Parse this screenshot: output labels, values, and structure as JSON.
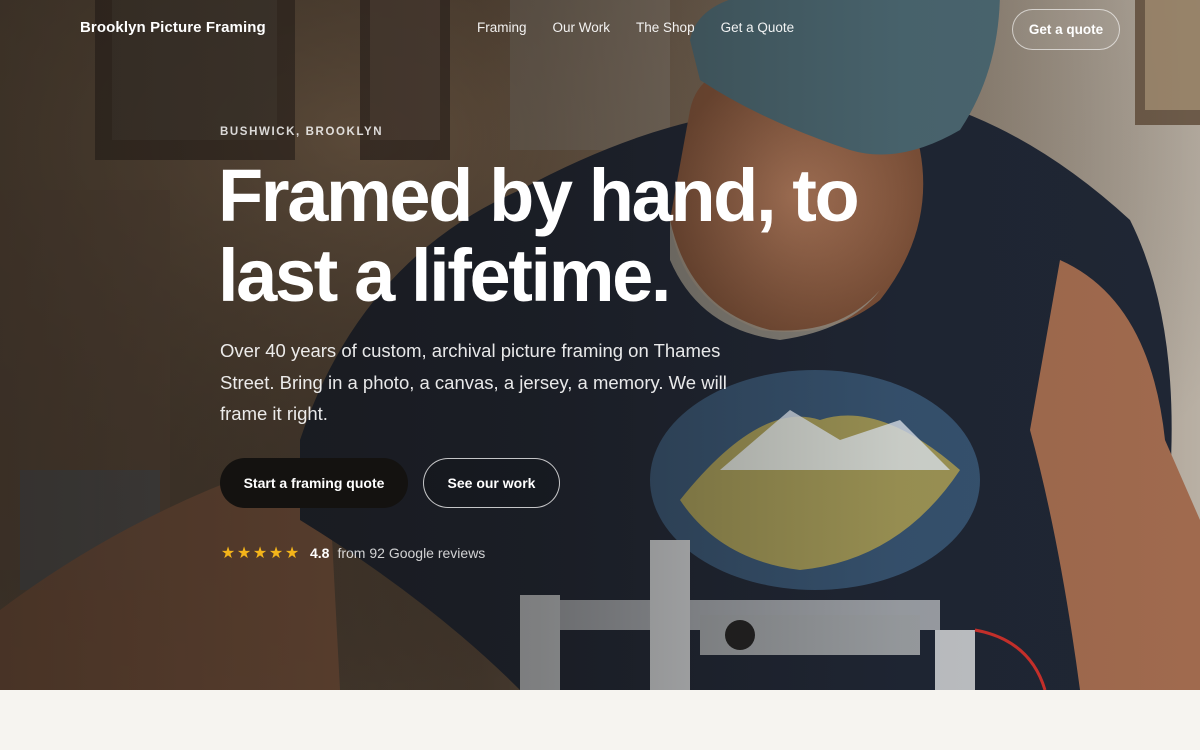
{
  "nav": {
    "brand": "Brooklyn Picture Framing",
    "links": [
      "Framing",
      "Our Work",
      "The Shop",
      "Get a Quote"
    ],
    "cta": "Get a quote"
  },
  "hero": {
    "eyebrow": "BUSHWICK, BROOKLYN",
    "headline_line1": "Framed by hand, to",
    "headline_line2": "last a lifetime.",
    "lede": "Over 40 years of custom, archival picture framing on Thames Street. Bring in a photo, a canvas, a jersey, a memory. We will frame it right.",
    "primary_button": "Start a framing quote",
    "secondary_button": "See our work",
    "rating": {
      "stars": 5,
      "score": "4.8",
      "text": "from 92 Google reviews"
    },
    "background_image": "framer-working-at-bench-photo"
  },
  "colors": {
    "star": "#f4b41a",
    "primary_button_bg": "#141210",
    "page_bg": "#f6f4f0"
  }
}
